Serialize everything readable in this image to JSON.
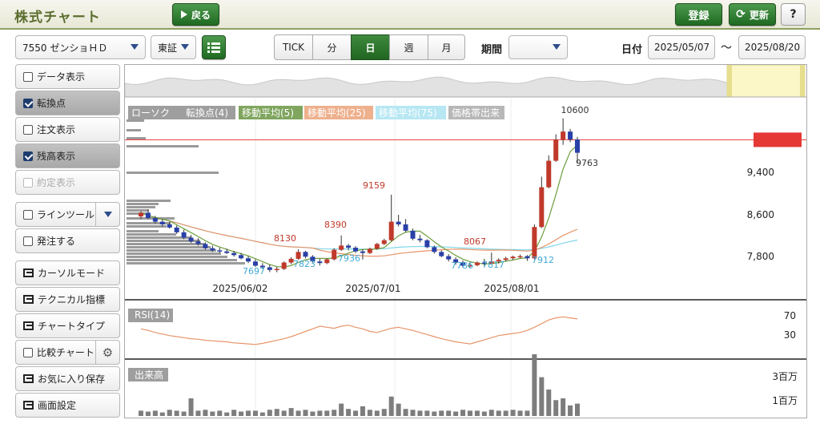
{
  "header": {
    "title": "株式チャート",
    "back_label": "戻る",
    "register_label": "登録",
    "refresh_label": "更新",
    "help_label": "?"
  },
  "toolbar": {
    "stock": "7550 ゼンショＨＤ",
    "exchange": "東証",
    "intervals": [
      "TICK",
      "分",
      "日",
      "週",
      "月"
    ],
    "selected_interval": "日",
    "period_label": "期間",
    "period_value": "",
    "date_label": "日付",
    "date_from": "2025/05/07",
    "date_sep": "〜",
    "date_to": "2025/08/20"
  },
  "sidebar": {
    "data_display": "データ表示",
    "turning_point": "転換点",
    "order_display": "注文表示",
    "balance_display": "残高表示",
    "execution_display": "約定表示",
    "line_tool": "ラインツール",
    "place_order": "発注する",
    "cursor_mode": "カーソルモード",
    "technical": "テクニカル指標",
    "chart_type": "チャートタイプ",
    "compare": "比較チャート",
    "save_favorite": "お気に入り保存",
    "screen_settings": "画面設定"
  },
  "chart": {
    "legend": [
      "ローソク",
      "転換点(4)",
      "移動平均(5)",
      "移動平均(25)",
      "移動平均(75)",
      "価格帯出来"
    ],
    "price_ticks": [
      "9,400",
      "8,600",
      "7,800"
    ],
    "current_price": "10195",
    "date_labels": [
      "2025/06/02",
      "2025/07/01",
      "2025/08/01"
    ],
    "turning_points": [
      "10600",
      "9763",
      "9159",
      "8390",
      "8130",
      "8067",
      "7697",
      "7823",
      "7936",
      "7786",
      "7817",
      "7912"
    ],
    "rsi_label": "RSI(14)",
    "rsi_ticks": [
      "70",
      "30"
    ],
    "volume_label": "出来高",
    "volume_ticks": [
      "3百万",
      "1百万"
    ]
  },
  "colors": {
    "up": "#c0392b",
    "down": "#2940a8",
    "ma5": "#6c9e3c",
    "ma25": "#e8956a",
    "ma75": "#7fd6ea",
    "accent": "#2e7d32",
    "current": "#e53935"
  },
  "chart_data": {
    "type": "candlestick",
    "ohlc": [
      [
        8750,
        8850,
        8700,
        8820
      ],
      [
        8820,
        8880,
        8700,
        8720
      ],
      [
        8720,
        8760,
        8620,
        8650
      ],
      [
        8650,
        8700,
        8560,
        8600
      ],
      [
        8600,
        8650,
        8520,
        8540
      ],
      [
        8540,
        8580,
        8420,
        8450
      ],
      [
        8450,
        8500,
        8320,
        8350
      ],
      [
        8350,
        8400,
        8250,
        8280
      ],
      [
        8280,
        8340,
        8200,
        8230
      ],
      [
        8230,
        8260,
        8120,
        8150
      ],
      [
        8150,
        8200,
        8080,
        8110
      ],
      [
        8110,
        8160,
        8060,
        8090
      ],
      [
        8090,
        8140,
        8040,
        8060
      ],
      [
        8060,
        8100,
        7990,
        8020
      ],
      [
        8020,
        8060,
        7940,
        7960
      ],
      [
        7960,
        8000,
        7870,
        7900
      ],
      [
        7900,
        7940,
        7800,
        7820
      ],
      [
        7820,
        7870,
        7760,
        7790
      ],
      [
        7790,
        7840,
        7700,
        7740
      ],
      [
        7740,
        7800,
        7697,
        7760
      ],
      [
        7760,
        7900,
        7740,
        7880
      ],
      [
        7880,
        7980,
        7850,
        7950
      ],
      [
        7950,
        8130,
        7930,
        8080
      ],
      [
        8080,
        8100,
        7960,
        7990
      ],
      [
        7990,
        8020,
        7880,
        7900
      ],
      [
        7900,
        7950,
        7823,
        7870
      ],
      [
        7870,
        7960,
        7850,
        7940
      ],
      [
        7940,
        8150,
        7920,
        8120
      ],
      [
        8120,
        8390,
        8100,
        8200
      ],
      [
        8200,
        8230,
        8110,
        8160
      ],
      [
        8160,
        8190,
        8060,
        8090
      ],
      [
        8090,
        8130,
        7936,
        8060
      ],
      [
        8060,
        8160,
        8040,
        8140
      ],
      [
        8140,
        8250,
        8120,
        8230
      ],
      [
        8230,
        8330,
        8210,
        8300
      ],
      [
        8300,
        9159,
        8280,
        8650
      ],
      [
        8650,
        8780,
        8560,
        8600
      ],
      [
        8600,
        8700,
        8450,
        8480
      ],
      [
        8480,
        8520,
        8300,
        8330
      ],
      [
        8330,
        8400,
        8260,
        8300
      ],
      [
        8300,
        8320,
        8150,
        8170
      ],
      [
        8170,
        8200,
        8050,
        8080
      ],
      [
        8080,
        8110,
        7980,
        8000
      ],
      [
        8000,
        8040,
        7900,
        7940
      ],
      [
        7940,
        7980,
        7840,
        7880
      ],
      [
        7880,
        7920,
        7786,
        7820
      ],
      [
        7820,
        7870,
        7790,
        7830
      ],
      [
        7830,
        7900,
        7810,
        7880
      ],
      [
        7880,
        7950,
        7817,
        7860
      ],
      [
        7860,
        8067,
        7850,
        7900
      ],
      [
        7900,
        7960,
        7860,
        7930
      ],
      [
        7930,
        7990,
        7900,
        7960
      ],
      [
        7960,
        8010,
        7930,
        7990
      ],
      [
        7990,
        8030,
        7960,
        8000
      ],
      [
        8000,
        8020,
        7912,
        7960
      ],
      [
        7960,
        8600,
        7940,
        8550
      ],
      [
        8550,
        9500,
        8530,
        9300
      ],
      [
        9300,
        9900,
        9280,
        9800
      ],
      [
        9800,
        10300,
        9780,
        10200
      ],
      [
        10200,
        10600,
        10100,
        10350
      ],
      [
        10350,
        10400,
        10150,
        10200
      ],
      [
        10200,
        10250,
        9763,
        9950
      ]
    ],
    "rsi": [
      55,
      52,
      48,
      45,
      42,
      40,
      38,
      36,
      35,
      33,
      32,
      31,
      30,
      28,
      27,
      26,
      25,
      27,
      30,
      33,
      36,
      40,
      45,
      50,
      55,
      60,
      58,
      56,
      60,
      62,
      58,
      55,
      50,
      48,
      52,
      56,
      58,
      55,
      52,
      48,
      44,
      40,
      36,
      33,
      30,
      28,
      26,
      30,
      34,
      38,
      42,
      44,
      46,
      48,
      52,
      58,
      65,
      72,
      76,
      78,
      76,
      74
    ],
    "volume_ticks_values": [
      1,
      3
    ]
  }
}
